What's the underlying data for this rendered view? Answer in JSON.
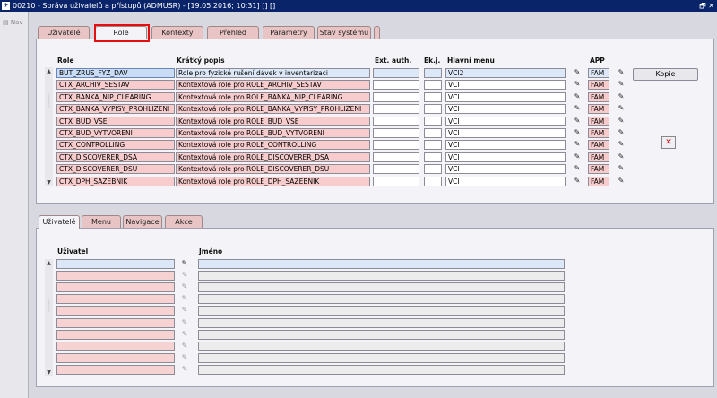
{
  "window": {
    "app_icon": "app-icon",
    "title": "00210 - Správa uživatelů a přístupů (ADMUSR) - [19.05.2016; 10:31] [] []",
    "controls": "restore-close-icons"
  },
  "nav": {
    "label": "Nav"
  },
  "top_tabs": [
    {
      "label": "Uživatelé"
    },
    {
      "label": "Role"
    },
    {
      "label": "Kontexty"
    },
    {
      "label": "Přehled"
    },
    {
      "label": "Parametry"
    },
    {
      "label": "Stav systému"
    }
  ],
  "roles_table": {
    "headers": {
      "role": "Role",
      "short_desc": "Krátký popis",
      "ext_auth": "Ext. auth.",
      "ekj": "Ek.j.",
      "main_menu": "Hlavní menu",
      "app": "APP"
    },
    "rows": [
      {
        "role": "BUT_ZRUS_FYZ_DAV",
        "desc": "Role pro fyzické rušení dávek v inventarizaci",
        "menu": "VCI2",
        "app": "FAM"
      },
      {
        "role": "CTX_ARCHIV_SESTAV",
        "desc": "Kontextová role pro ROLE_ARCHIV_SESTAV",
        "menu": "VCI",
        "app": "FAM"
      },
      {
        "role": "CTX_BANKA_NIP_CLEARING",
        "desc": "Kontextová role pro ROLE_BANKA_NIP_CLEARING",
        "menu": "VCI",
        "app": "FAM"
      },
      {
        "role": "CTX_BANKA_VYPISY_PROHLIZENI",
        "desc": "Kontextová role pro ROLE_BANKA_VYPISY_PROHLIZENI",
        "menu": "VCI",
        "app": "FAM"
      },
      {
        "role": "CTX_BUD_VSE",
        "desc": "Kontextová role pro ROLE_BUD_VSE",
        "menu": "VCI",
        "app": "FAM"
      },
      {
        "role": "CTX_BUD_VYTVORENI",
        "desc": "Kontextová role pro ROLE_BUD_VYTVORENI",
        "menu": "VCI",
        "app": "FAM"
      },
      {
        "role": "CTX_CONTROLLING",
        "desc": "Kontextová role pro ROLE_CONTROLLING",
        "menu": "VCI",
        "app": "FAM"
      },
      {
        "role": "CTX_DISCOVERER_DSA",
        "desc": "Kontextová role pro ROLE_DISCOVERER_DSA",
        "menu": "VCI",
        "app": "FAM"
      },
      {
        "role": "CTX_DISCOVERER_DSU",
        "desc": "Kontextová role pro ROLE_DISCOVERER_DSU",
        "menu": "VCI",
        "app": "FAM"
      },
      {
        "role": "CTX_DPH_SAZEBNIK",
        "desc": "Kontextová role pro ROLE_DPH_SAZEBNIK",
        "menu": "VCI",
        "app": "FAM"
      }
    ],
    "copy_button": "Kopie",
    "delete_icon": "delete-record-icon",
    "edit_icon": "edit-icon"
  },
  "bottom_tabs": [
    {
      "label": "Uživatelé"
    },
    {
      "label": "Menu"
    },
    {
      "label": "Navigace"
    },
    {
      "label": "Akce"
    }
  ],
  "users_table": {
    "headers": {
      "user": "Uživatel",
      "name": "Jméno"
    },
    "row_count": 10
  },
  "colors": {
    "title_bar": "#0a246a",
    "required_field": "#f8cccc",
    "selected_field": "#c8dcf4",
    "highlight": "#e41010"
  }
}
